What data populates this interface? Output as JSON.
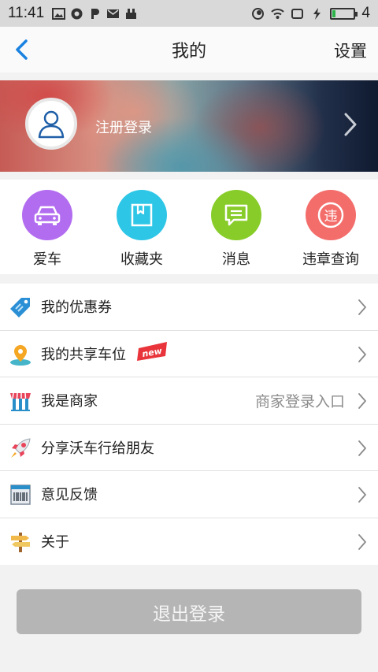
{
  "status_bar": {
    "time": "11:41",
    "battery_level": "4"
  },
  "nav": {
    "title": "我的",
    "settings_label": "设置"
  },
  "profile": {
    "login_label": "注册登录"
  },
  "quick_actions": [
    {
      "label": "爱车",
      "color": "#b26cf0",
      "icon": "car-icon"
    },
    {
      "label": "收藏夹",
      "color": "#2ec6e6",
      "icon": "bookmark-icon"
    },
    {
      "label": "消息",
      "color": "#88cc2a",
      "icon": "message-icon"
    },
    {
      "label": "违章查询",
      "color": "#f36d6b",
      "icon": "violation-icon",
      "glyph": "违"
    }
  ],
  "menu": [
    {
      "label": "我的优惠券",
      "icon": "coupon-icon",
      "right": ""
    },
    {
      "label": "我的共享车位",
      "icon": "location-pin-icon",
      "right": "",
      "badge": "new"
    },
    {
      "label": "我是商家",
      "icon": "store-icon",
      "right": "商家登录入口"
    },
    {
      "label": "分享沃车行给朋友",
      "icon": "rocket-icon",
      "right": ""
    },
    {
      "label": "意见反馈",
      "icon": "feedback-icon",
      "right": ""
    },
    {
      "label": "关于",
      "icon": "signpost-icon",
      "right": ""
    }
  ],
  "logout_label": "退出登录"
}
